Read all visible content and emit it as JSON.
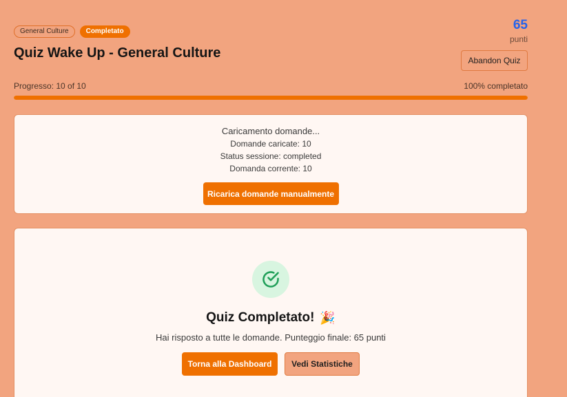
{
  "header": {
    "category_badge": "General Culture",
    "status_badge": "Completato",
    "title": "Quiz Wake Up - General Culture"
  },
  "score": {
    "value": "65",
    "unit": "punti"
  },
  "abandon_label": "Abandon Quiz",
  "progress": {
    "label": "Progresso: 10 of 10",
    "percent_label": "100% completato",
    "fraction": 1.0
  },
  "loading": {
    "title": "Caricamento domande...",
    "lines": [
      "Domande caricate: 10",
      "Status sessione: completed",
      "Domanda corrente: 10"
    ],
    "reload_label": "Ricarica domande manualmente"
  },
  "completion": {
    "title": "Quiz Completato!",
    "party_emoji": "🎉",
    "message": "Hai risposto a tutte le domande. Punteggio finale: 65 punti",
    "dashboard_label": "Torna alla Dashboard",
    "stats_label": "Vedi Statistiche"
  },
  "colors": {
    "background": "#f2a47f",
    "accent": "#ef7000",
    "score": "#2563eb",
    "success": "#22a05a"
  },
  "icons": {
    "completion": "check-circle-icon"
  }
}
